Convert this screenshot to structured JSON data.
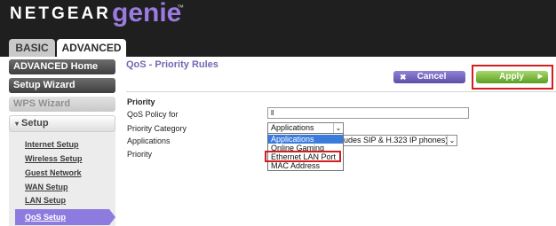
{
  "header": {
    "brand": "NETGEAR",
    "product": "genie",
    "tm": "™"
  },
  "tabs": [
    {
      "label": "BASIC",
      "active": false
    },
    {
      "label": "ADVANCED",
      "active": true
    }
  ],
  "sidebar": {
    "items": [
      {
        "label": "ADVANCED Home",
        "enabled": true
      },
      {
        "label": "Setup Wizard",
        "enabled": true
      },
      {
        "label": "WPS Wizard",
        "enabled": false
      }
    ],
    "setup_section": {
      "arrow": "▾",
      "label": "Setup",
      "links": [
        "Internet Setup",
        "Wireless Setup",
        "Guest Network",
        "WAN Setup",
        "LAN Setup",
        "QoS Setup"
      ],
      "active_link": "QoS Setup"
    }
  },
  "main": {
    "title": "QoS - Priority Rules",
    "cancel_label": "Cancel",
    "apply_label": "Apply",
    "section_heading": "Priority",
    "form": {
      "policy_label": "QoS Policy for",
      "policy_value": "ll",
      "category_label": "Priority Category",
      "category_value": "Applications",
      "applications_label": "Applications",
      "applications_value_visible": "udes SIP & H.323 IP phones)",
      "priority_label": "Priority"
    },
    "category_dropdown": {
      "options": [
        "Applications",
        "Online Gaming",
        "Ethernet LAN Port",
        "MAC Address"
      ],
      "selected": "Applications",
      "highlighted": "Ethernet LAN Port"
    }
  },
  "colors": {
    "header_bg": "#1f1f1f",
    "genie_purple": "#9b7be0",
    "title_purple": "#6f6ab4",
    "apply_green": "#6aab2c",
    "highlight_red": "#d11e1e",
    "selection_blue": "#3a7bdc"
  },
  "icons": {
    "cancel": "close-x-icon",
    "apply": "play-triangle-icon",
    "setup_expand": "triangle-down-icon",
    "select_chevron": "chevron-down-icon"
  }
}
